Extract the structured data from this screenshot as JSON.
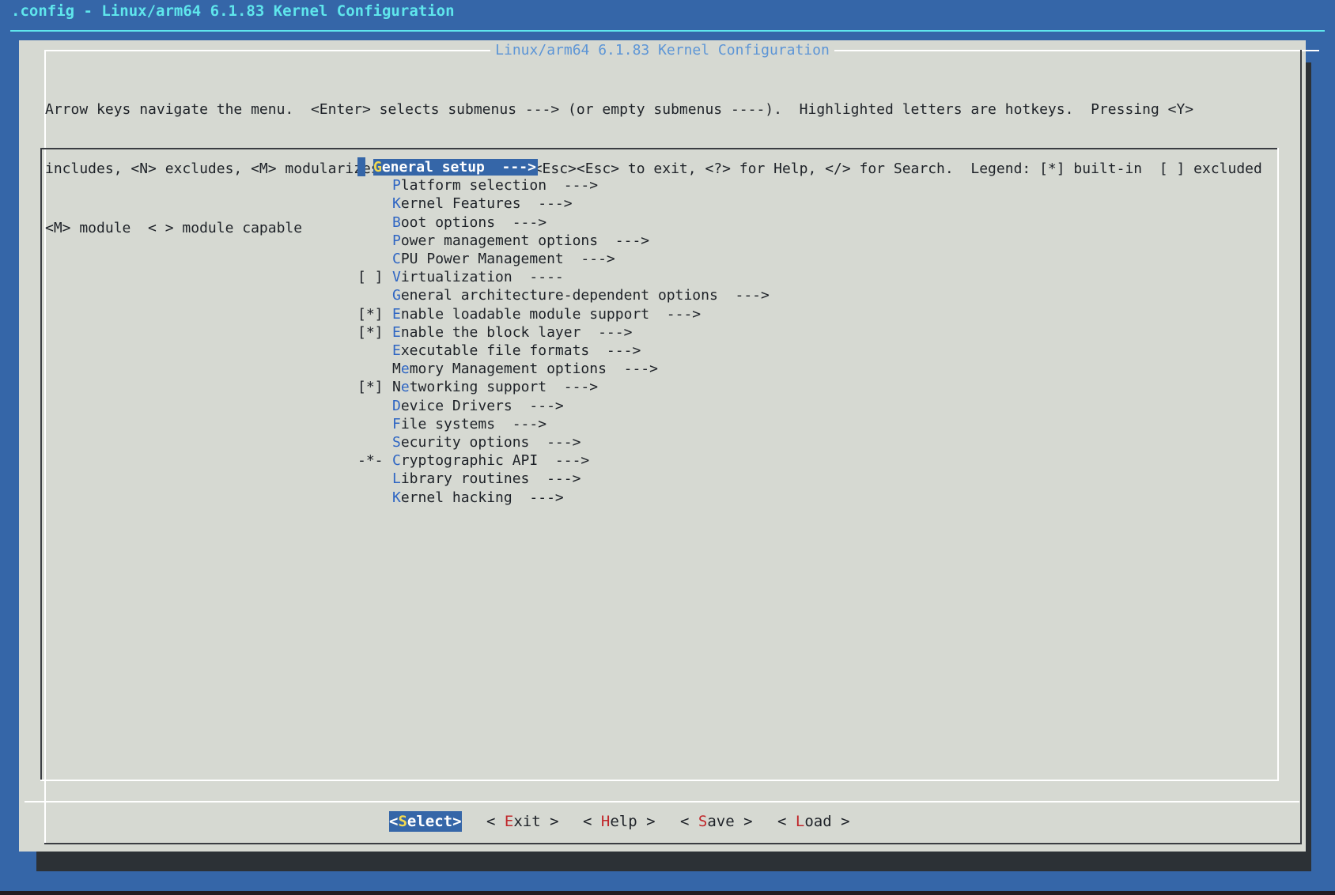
{
  "window": {
    "title": ".config - Linux/arm64 6.1.83 Kernel Configuration"
  },
  "dialog": {
    "title": "Linux/arm64 6.1.83 Kernel Configuration",
    "help_lines": [
      "Arrow keys navigate the menu.  <Enter> selects submenus ---> (or empty submenus ----).  Highlighted letters are hotkeys.  Pressing <Y>",
      "includes, <N> excludes, <M> modularizes features.  Press <Esc><Esc> to exit, <?> for Help, </> for Search.  Legend: [*] built-in  [ ] excluded",
      "<M> module  < > module capable"
    ]
  },
  "menu": {
    "selected_index": 0,
    "items": [
      {
        "mark": "",
        "pre": "",
        "hot": "G",
        "rest": "eneral setup  --->"
      },
      {
        "mark": "",
        "pre": "",
        "hot": "P",
        "rest": "latform selection  --->"
      },
      {
        "mark": "",
        "pre": "",
        "hot": "K",
        "rest": "ernel Features  --->"
      },
      {
        "mark": "",
        "pre": "",
        "hot": "B",
        "rest": "oot options  --->"
      },
      {
        "mark": "",
        "pre": "",
        "hot": "P",
        "rest": "ower management options  --->"
      },
      {
        "mark": "",
        "pre": "",
        "hot": "C",
        "rest": "PU Power Management  --->"
      },
      {
        "mark": "[ ]",
        "pre": "",
        "hot": "V",
        "rest": "irtualization  ----"
      },
      {
        "mark": "",
        "pre": "",
        "hot": "G",
        "rest": "eneral architecture-dependent options  --->"
      },
      {
        "mark": "[*]",
        "pre": "",
        "hot": "E",
        "rest": "nable loadable module support  --->"
      },
      {
        "mark": "[*]",
        "pre": "",
        "hot": "E",
        "rest": "nable the block layer  --->"
      },
      {
        "mark": "",
        "pre": "",
        "hot": "E",
        "rest": "xecutable file formats  --->"
      },
      {
        "mark": "",
        "pre": "M",
        "hot": "e",
        "rest": "mory Management options  --->"
      },
      {
        "mark": "[*]",
        "pre": "N",
        "hot": "e",
        "rest": "tworking support  --->"
      },
      {
        "mark": "",
        "pre": "",
        "hot": "D",
        "rest": "evice Drivers  --->"
      },
      {
        "mark": "",
        "pre": "",
        "hot": "F",
        "rest": "ile systems  --->"
      },
      {
        "mark": "",
        "pre": "",
        "hot": "S",
        "rest": "ecurity options  --->"
      },
      {
        "mark": "-*-",
        "pre": "",
        "hot": "C",
        "rest": "ryptographic API  --->"
      },
      {
        "mark": "",
        "pre": "",
        "hot": "L",
        "rest": "ibrary routines  --->"
      },
      {
        "mark": "",
        "pre": "",
        "hot": "K",
        "rest": "ernel hacking  --->"
      }
    ]
  },
  "buttons": [
    {
      "pre": "<",
      "hot": "S",
      "rest": "elect>",
      "active": true
    },
    {
      "pre": "< ",
      "hot": "E",
      "rest": "xit >",
      "active": false
    },
    {
      "pre": "< ",
      "hot": "H",
      "rest": "elp >",
      "active": false
    },
    {
      "pre": "< ",
      "hot": "S",
      "rest": "ave >",
      "active": false
    },
    {
      "pre": "< ",
      "hot": "L",
      "rest": "oad >",
      "active": false
    }
  ],
  "colors": {
    "screen_bg": "#3566a8",
    "dialog_bg": "#d6d9d2",
    "title_cyan": "#5fe6ec",
    "hotkey_blue": "#2f66c3",
    "hotkey_red": "#c0262a",
    "selected_hotkey": "#f4d94e"
  }
}
